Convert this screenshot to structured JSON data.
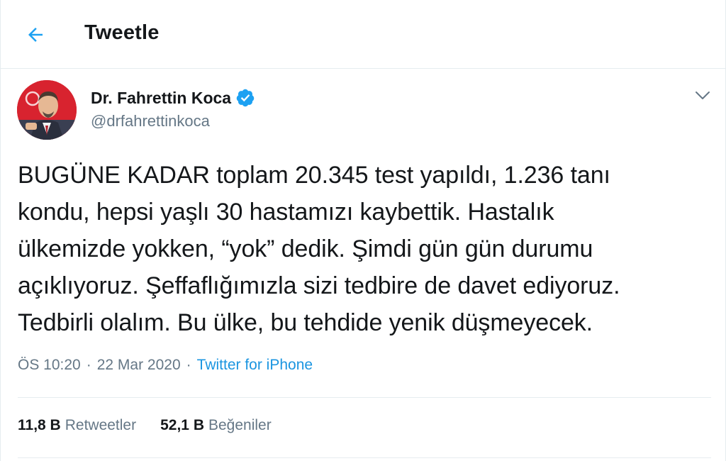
{
  "header": {
    "title": "Tweetle",
    "back_icon": "arrow-left-icon"
  },
  "author": {
    "display_name": "Dr. Fahrettin Koca",
    "handle": "@drfahrettinkoca",
    "verified": true,
    "verified_color": "#1da1f2"
  },
  "tweet": {
    "text": "BUGÜNE KADAR toplam 20.345 test yapıldı, 1.236 tanı\nkondu, hepsi yaşlı 30 hastamızı kaybettik. Hastalık\nülkemizde yokken, “yok” dedik. Şimdi gün gün durumu\naçıklıyoruz. Şeffaflığımızla sizi tedbire de davet ediyoruz.\nTedbirli olalım. Bu ülke, bu tehdide yenik düşmeyecek.",
    "time": "ÖS 10:20",
    "separator": "·",
    "date": "22 Mar 2020",
    "source": "Twitter for iPhone"
  },
  "stats": {
    "retweets_count": "11,8 B",
    "retweets_label": "Retweetler",
    "likes_count": "52,1 B",
    "likes_label": "Beğeniler"
  },
  "colors": {
    "accent": "#1da1f2",
    "link": "#1b95e0",
    "muted": "#657786",
    "border": "#e6ecf0"
  }
}
